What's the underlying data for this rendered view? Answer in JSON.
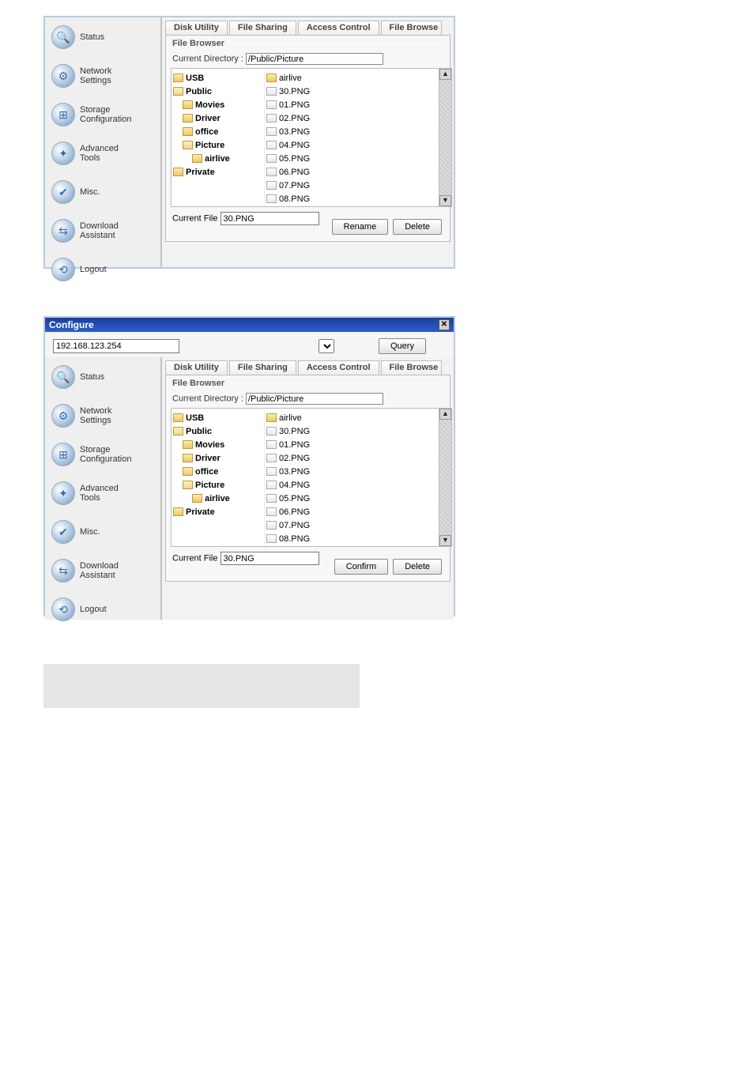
{
  "panel1": {
    "tabs": [
      "Disk Utility",
      "File Sharing",
      "Access Control",
      "File Browse"
    ],
    "fieldset_title": "File Browser",
    "curdir_label": "Current Directory :",
    "curdir_value": "/Public/Picture",
    "sidebar": [
      {
        "label": "Status",
        "glyph": "🔍"
      },
      {
        "label": "Network\nSettings",
        "glyph": "⚙"
      },
      {
        "label": "Storage\nConfiguration",
        "glyph": "⊞"
      },
      {
        "label": "Advanced\nTools",
        "glyph": "✦"
      },
      {
        "label": "Misc.",
        "glyph": "✔"
      },
      {
        "label": "Download\nAssistant",
        "glyph": "⇆"
      },
      {
        "label": "Logout",
        "glyph": "⟲"
      }
    ],
    "tree": [
      {
        "label": "USB",
        "kind": "folder",
        "bold": true,
        "ind": 0,
        "open": false
      },
      {
        "label": "Public",
        "kind": "folder",
        "bold": true,
        "ind": 0,
        "open": true
      },
      {
        "label": "Movies",
        "kind": "folder",
        "bold": true,
        "ind": 1,
        "open": false
      },
      {
        "label": "Driver",
        "kind": "folder",
        "bold": true,
        "ind": 1,
        "open": false
      },
      {
        "label": "office",
        "kind": "folder",
        "bold": true,
        "ind": 1,
        "open": false
      },
      {
        "label": "Picture",
        "kind": "folder",
        "bold": true,
        "ind": 1,
        "open": true
      },
      {
        "label": "airlive",
        "kind": "folder",
        "bold": true,
        "ind": 2,
        "open": false
      },
      {
        "label": "Private",
        "kind": "folder",
        "bold": true,
        "ind": 0,
        "open": false
      }
    ],
    "files": [
      {
        "label": "airlive",
        "kind": "folder"
      },
      {
        "label": "30.PNG",
        "kind": "file"
      },
      {
        "label": "01.PNG",
        "kind": "file"
      },
      {
        "label": "02.PNG",
        "kind": "file"
      },
      {
        "label": "03.PNG",
        "kind": "file"
      },
      {
        "label": "04.PNG",
        "kind": "file"
      },
      {
        "label": "05.PNG",
        "kind": "file"
      },
      {
        "label": "06.PNG",
        "kind": "file"
      },
      {
        "label": "07.PNG",
        "kind": "file"
      },
      {
        "label": "08.PNG",
        "kind": "file"
      }
    ],
    "curfile_label": "Current File",
    "curfile_value": "30.PNG",
    "btn1": "Rename",
    "btn2": "Delete"
  },
  "panel2": {
    "window_title": "Configure",
    "addr": "192.168.123.254",
    "query": "Query",
    "tabs": [
      "Disk Utility",
      "File Sharing",
      "Access Control",
      "File Browse"
    ],
    "fieldset_title": "File Browser",
    "curdir_label": "Current Directory :",
    "curdir_value": "/Public/Picture",
    "sidebar": [
      {
        "label": "Status",
        "glyph": "🔍"
      },
      {
        "label": "Network\nSettings",
        "glyph": "⚙"
      },
      {
        "label": "Storage\nConfiguration",
        "glyph": "⊞"
      },
      {
        "label": "Advanced\nTools",
        "glyph": "✦"
      },
      {
        "label": "Misc.",
        "glyph": "✔"
      },
      {
        "label": "Download\nAssistant",
        "glyph": "⇆"
      },
      {
        "label": "Logout",
        "glyph": "⟲"
      }
    ],
    "tree": [
      {
        "label": "USB",
        "kind": "folder",
        "bold": true,
        "ind": 0,
        "open": false
      },
      {
        "label": "Public",
        "kind": "folder",
        "bold": true,
        "ind": 0,
        "open": true
      },
      {
        "label": "Movies",
        "kind": "folder",
        "bold": true,
        "ind": 1,
        "open": false
      },
      {
        "label": "Driver",
        "kind": "folder",
        "bold": true,
        "ind": 1,
        "open": false
      },
      {
        "label": "office",
        "kind": "folder",
        "bold": true,
        "ind": 1,
        "open": false
      },
      {
        "label": "Picture",
        "kind": "folder",
        "bold": true,
        "ind": 1,
        "open": true
      },
      {
        "label": "airlive",
        "kind": "folder",
        "bold": true,
        "ind": 2,
        "open": false
      },
      {
        "label": "Private",
        "kind": "folder",
        "bold": true,
        "ind": 0,
        "open": false
      }
    ],
    "files": [
      {
        "label": "airlive",
        "kind": "folder"
      },
      {
        "label": "30.PNG",
        "kind": "file"
      },
      {
        "label": "01.PNG",
        "kind": "file"
      },
      {
        "label": "02.PNG",
        "kind": "file"
      },
      {
        "label": "03.PNG",
        "kind": "file"
      },
      {
        "label": "04.PNG",
        "kind": "file"
      },
      {
        "label": "05.PNG",
        "kind": "file"
      },
      {
        "label": "06.PNG",
        "kind": "file"
      },
      {
        "label": "07.PNG",
        "kind": "file"
      },
      {
        "label": "08.PNG",
        "kind": "file"
      }
    ],
    "curfile_label": "Current File",
    "curfile_value": "30.PNG",
    "btn1": "Confirm",
    "btn2": "Delete"
  }
}
